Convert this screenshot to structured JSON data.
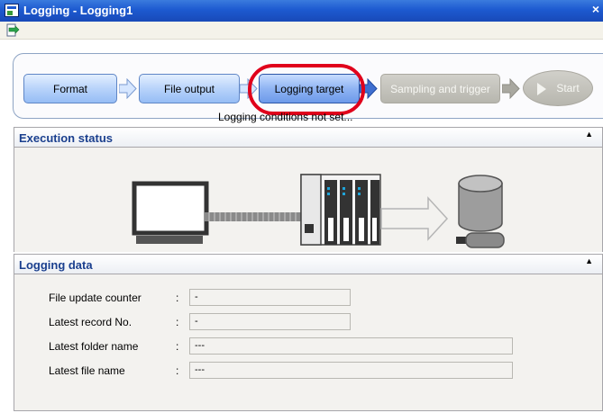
{
  "window": {
    "title": "Logging - Logging1"
  },
  "wizard": {
    "steps": [
      {
        "label": "Format",
        "state": "active"
      },
      {
        "label": "File output",
        "state": "active"
      },
      {
        "label": "Logging target",
        "state": "selected"
      },
      {
        "label": "Sampling and trigger",
        "state": "disabled"
      },
      {
        "label": "Start",
        "state": "disabled"
      }
    ],
    "highlight_color": "#e0001b"
  },
  "execution_status": {
    "title": "Execution status",
    "status_text": "Logging conditions not set..."
  },
  "logging_data": {
    "title": "Logging data",
    "fields": [
      {
        "label": "File update counter",
        "colon": ":",
        "value": "-"
      },
      {
        "label": "Latest record No.",
        "colon": ":",
        "value": "-"
      },
      {
        "label": "Latest folder name",
        "colon": ":",
        "value": "---"
      },
      {
        "label": "Latest file name",
        "colon": ":",
        "value": "---"
      }
    ]
  },
  "colors": {
    "title_bar": "#1d5ad0",
    "panel_title": "#1a3f8e",
    "panel_bg": "#f3f2ef"
  }
}
